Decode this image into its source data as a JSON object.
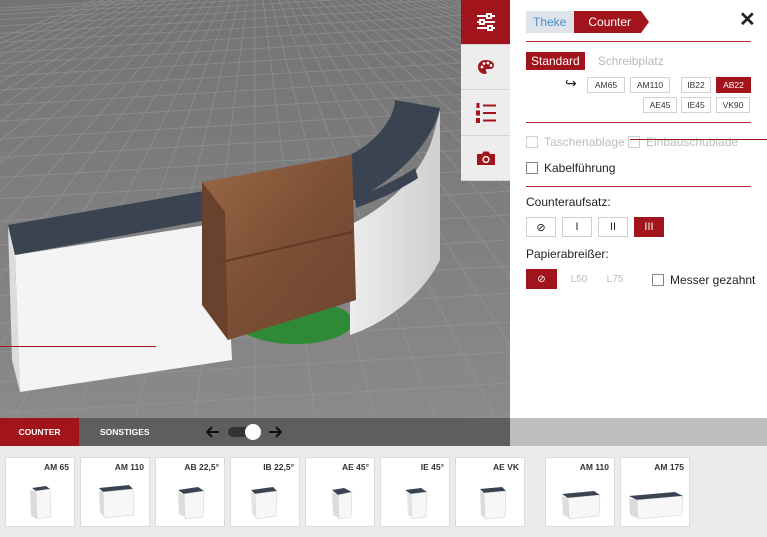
{
  "toolbar": {
    "items": [
      {
        "icon": "sliders-icon",
        "active": true
      },
      {
        "icon": "palette-icon",
        "active": false
      },
      {
        "icon": "numbered-list-icon",
        "active": false
      },
      {
        "icon": "camera-icon",
        "active": false
      }
    ]
  },
  "panel": {
    "breadcrumb": [
      "Theke",
      "Counter"
    ],
    "close_glyph": "✕",
    "mode_tabs": [
      "Standard",
      "Schreibplatz"
    ],
    "return_arrow": "↪",
    "variants": [
      "AM65",
      "AM110",
      "IB22",
      "AB22",
      "AE45",
      "IE45",
      "VK90"
    ],
    "checkboxes": {
      "taschenablage": "Taschenablage",
      "einbauschublade": "Einbauschublade",
      "kabelfuehrung": "Kabelführung"
    },
    "counteraufsatz": {
      "label": "Counteraufsatz:",
      "options": [
        "⊘",
        "I",
        "II",
        "III"
      ]
    },
    "papierabreisser": {
      "label": "Papierabreißer:",
      "options": [
        "⊘",
        "L50",
        "L75"
      ],
      "messer_label": "Messer gezahnt"
    }
  },
  "bottom_tabs": [
    "COUNTER",
    "SONSTIGES"
  ],
  "catalog": {
    "items": [
      "AM 65",
      "AM 110",
      "AB 22,5°",
      "IB 22,5°",
      "AE 45°",
      "IE 45°",
      "AE VK",
      "AM 110",
      "AM 175"
    ]
  },
  "colors": {
    "accent": "#a1141b",
    "breadcrumb_link": "#4b8fc9",
    "countertop": "#3a4352",
    "wood": "#8a5a3c",
    "floor": "#7c7c7c",
    "mat": "#2f8a37"
  }
}
